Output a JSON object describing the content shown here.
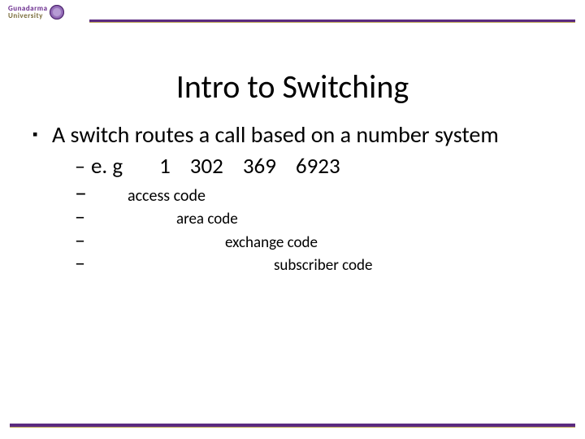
{
  "logo": {
    "line1": "Gunadarma",
    "line2": "University"
  },
  "title": "Intro to Switching",
  "bullet": "A switch routes a call based on a number system",
  "example_label": "e. g",
  "numbers": {
    "n1": "1",
    "n2": "302",
    "n3": "369",
    "n4": "6923"
  },
  "codes": {
    "access": "access code",
    "area": "area code",
    "exchange": "exchange code",
    "subscriber": "subscriber code"
  }
}
